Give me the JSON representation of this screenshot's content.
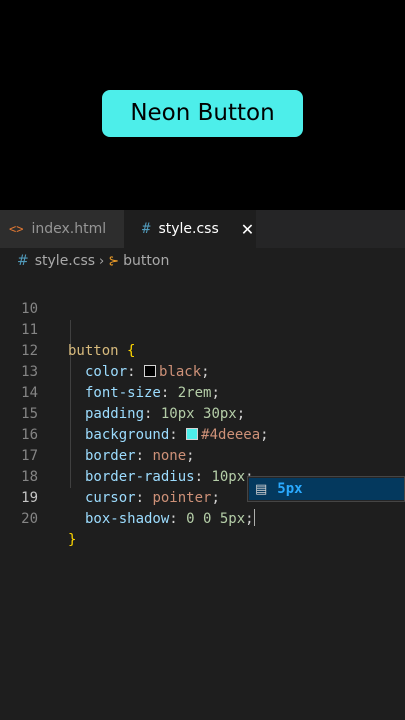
{
  "preview": {
    "button_label": "Neon Button",
    "button_color": "#4deeea"
  },
  "tabs": [
    {
      "label": "index.html",
      "icon": "html-file-icon",
      "icon_glyph": "<>",
      "active": false
    },
    {
      "label": "style.css",
      "icon": "css-file-icon",
      "icon_glyph": "#",
      "active": true,
      "close_glyph": "✕"
    }
  ],
  "breadcrumb": {
    "file": "style.css",
    "symbol": "button"
  },
  "code": {
    "lines": [
      {
        "number": "10"
      },
      {
        "number": "11",
        "selector": "button",
        "brace": "{"
      },
      {
        "number": "12",
        "prop": "color",
        "value": "black",
        "swatch": "#000000"
      },
      {
        "number": "13",
        "prop": "font-size",
        "value": "2rem"
      },
      {
        "number": "14",
        "prop": "padding",
        "value": "10px 30px"
      },
      {
        "number": "15",
        "prop": "background",
        "value": "#4deeea",
        "swatch": "#4deeea"
      },
      {
        "number": "16",
        "prop": "border",
        "value": "none"
      },
      {
        "number": "17",
        "prop": "border-radius",
        "value": "10px"
      },
      {
        "number": "18",
        "prop": "cursor",
        "value": "pointer"
      },
      {
        "number": "19",
        "prop": "box-shadow",
        "value": "0 0 5px"
      },
      {
        "number": "20",
        "brace": "}"
      }
    ],
    "current_line": "19"
  },
  "suggest": {
    "icon": "ruler-icon",
    "label": "5px"
  }
}
